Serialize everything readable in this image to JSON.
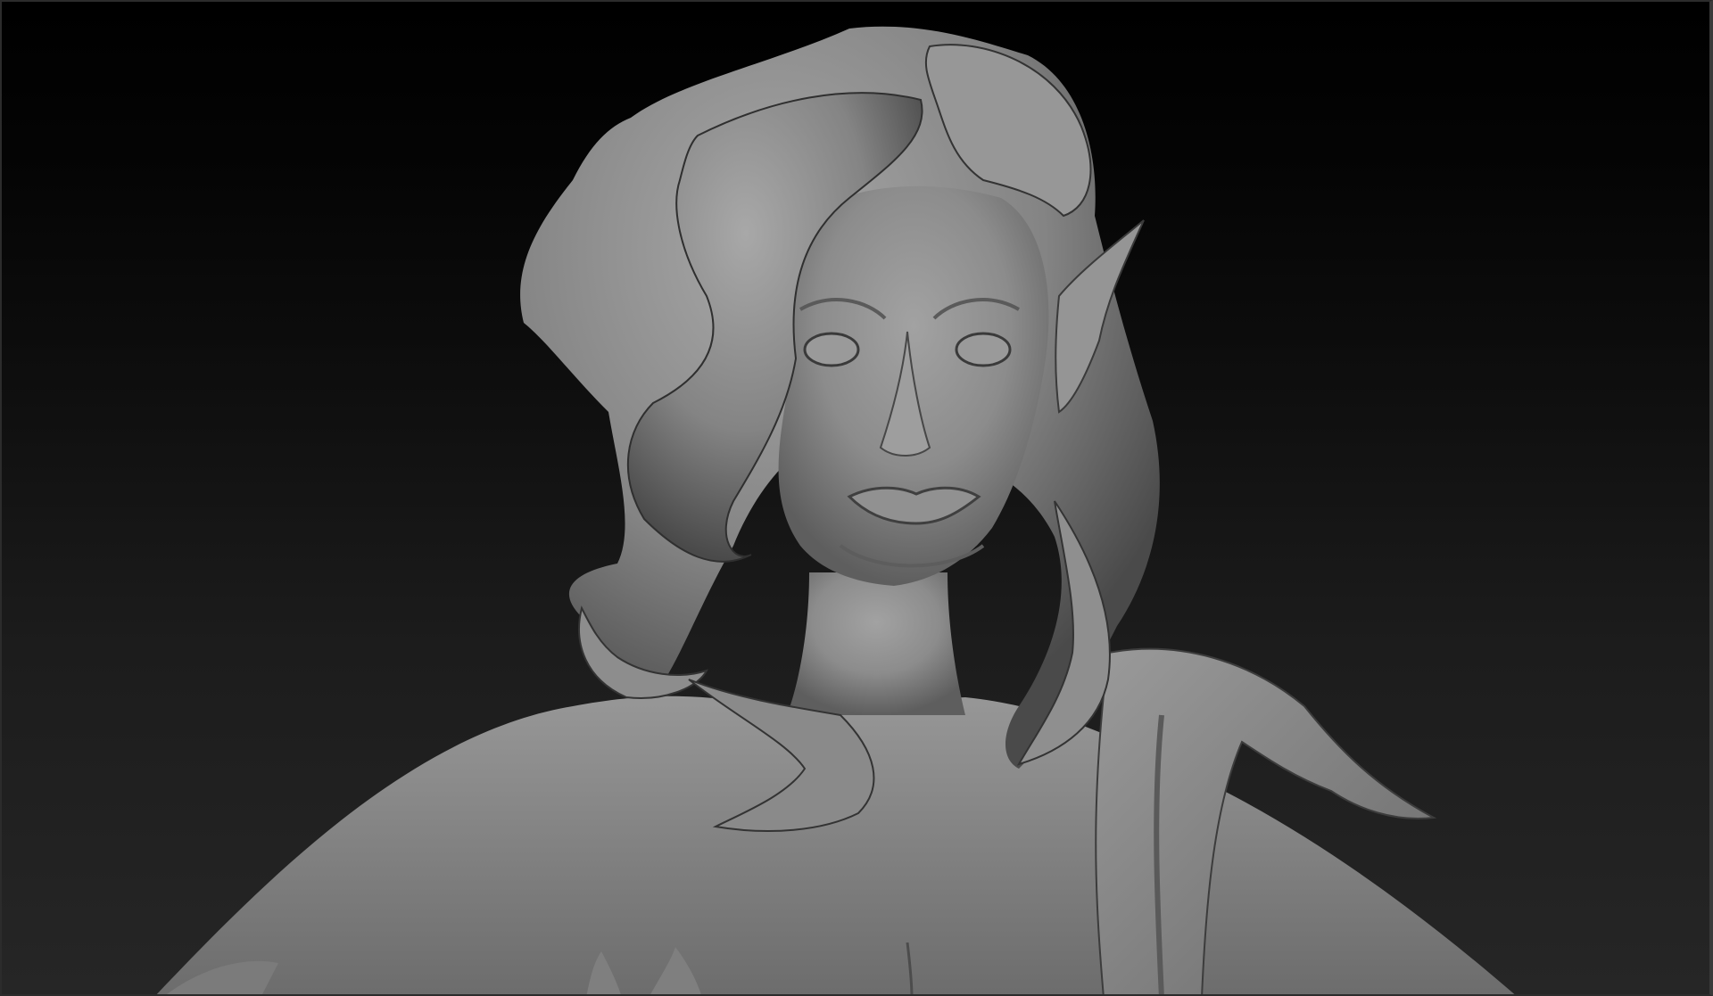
{
  "viewport": {
    "background_top": "#000000",
    "background_bottom": "#262626",
    "material_color": "#8a8a8a",
    "material_highlight": "#a6a6a6",
    "material_shadow": "#3a3a3a"
  },
  "model": {
    "icon": "sculpt-model-icon"
  }
}
